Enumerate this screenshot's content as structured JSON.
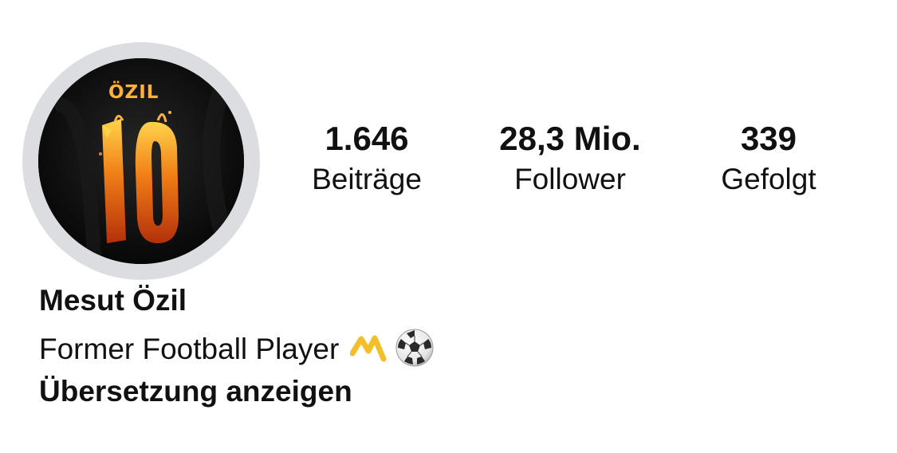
{
  "profile": {
    "name": "Mesut Özil",
    "bio": "Former Football Player",
    "bio_icons": [
      "yellow-m-icon",
      "soccer-ball-icon"
    ],
    "translate_label": "Übersetzung anzeigen",
    "avatar": {
      "description_icon": "jersey-10-icon",
      "jersey_name": "ÖZIL",
      "jersey_number": "10"
    }
  },
  "stats": [
    {
      "value": "1.646",
      "label": "Beiträge"
    },
    {
      "value": "28,3 Mio.",
      "label": "Follower"
    },
    {
      "value": "339",
      "label": "Gefolgt"
    }
  ],
  "colors": {
    "text": "#111111",
    "ring": "#dcdde1",
    "flame_orange": "#f07d16",
    "flame_yellow": "#ffd34a",
    "m_icon_yellow": "#f2bf2b"
  }
}
